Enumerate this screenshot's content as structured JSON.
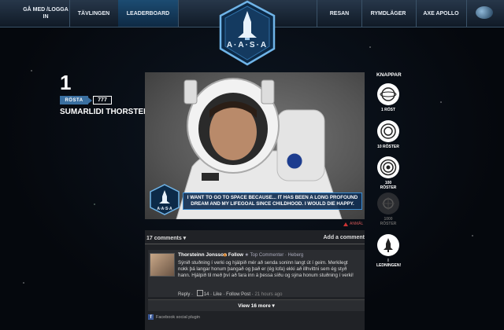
{
  "nav": {
    "left": [
      {
        "label": "Gå med /logga in",
        "active": false
      },
      {
        "label": "Tävlingen",
        "active": false
      },
      {
        "label": "Leaderboard",
        "active": true
      }
    ],
    "right": [
      {
        "label": "Resan"
      },
      {
        "label": "Rymdläger"
      },
      {
        "label": "Axe Apollo"
      }
    ]
  },
  "logo": {
    "text": "A·A·S·A",
    "badge_icon": "axe-shuttle-icon"
  },
  "entry": {
    "rank": "1",
    "vote_label": "RÖSTA",
    "vote_count": "777",
    "name": "Sumarlidi Thorsteinsson",
    "quote": "I want to go to space because... it has been a long profound dream and my lifegoal since childhood. I would die happy.",
    "quote_logo_text": "A·A·S·A",
    "report_label": "ANMÄL"
  },
  "comments": {
    "count_label": "17 comments ▾",
    "add_label": "Add a comment",
    "items": [
      {
        "author": "Thorsteinn Jonsson",
        "follow": "Follow",
        "badge": "Top Commenter · Heberg",
        "text": "Sýnið stuðning í verki og hjálpið mér að senda soninn langt út í geim. Merkilegt nokk þá langar honum þangað og það er (ég lofa) ekki að illhvittni sem ég styð hann. Hjálpið til með því að fara inn á þessa síðu og sýna honum stuðning í verki!",
        "reply": "Reply",
        "likes": "14",
        "like": "Like",
        "follow_post": "Follow Post",
        "time": "21 hours ago"
      }
    ],
    "view_more": "View 16 more ▾",
    "plugin_label": "Facebook social plugin"
  },
  "buttons": {
    "title": "KNAPPAR",
    "items": [
      {
        "label": "1 RÖST",
        "icon": "ring-icon",
        "enabled": true
      },
      {
        "label": "10 RÖSTER",
        "icon": "double-ring-icon",
        "enabled": true
      },
      {
        "label": "100 RÖSTER",
        "icon": "triple-ring-icon",
        "enabled": true
      },
      {
        "label": "1000 RÖSTER",
        "icon": "disabled-ring-icon",
        "enabled": false
      },
      {
        "label": "I LEDNINGEN!",
        "icon": "rocket-icon",
        "enabled": true
      }
    ]
  },
  "colors": {
    "accent": "#3a6fa0",
    "nav_active": "#1c4c72",
    "comment_bg": "#202226"
  }
}
